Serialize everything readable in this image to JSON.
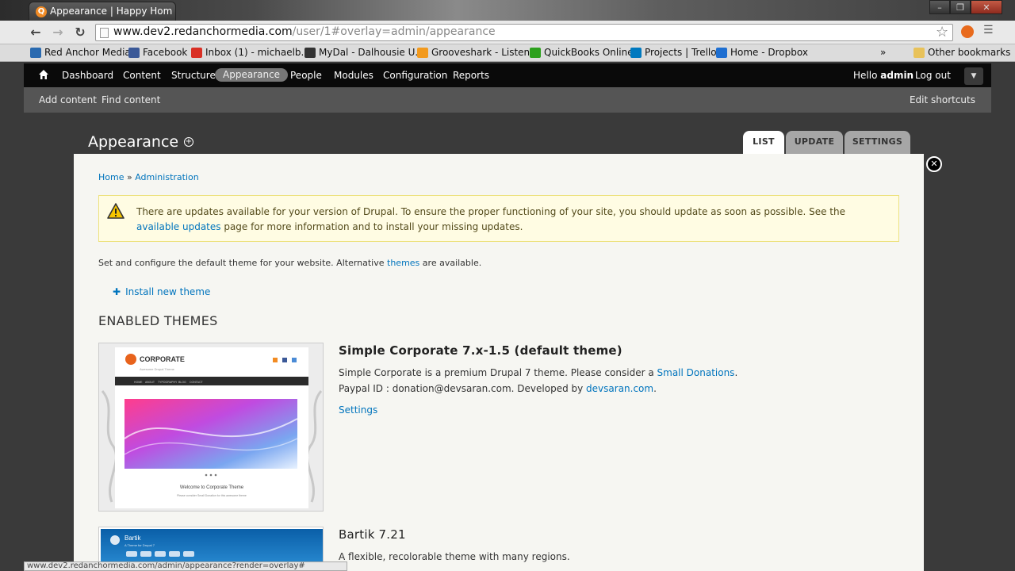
{
  "browser": {
    "tab_title": "Appearance | Happy Hom",
    "url_host": "www.dev2.redanchormedia.com",
    "url_path": "/user/1#overlay=admin/appearance",
    "window_controls": [
      "–",
      "❐",
      "✕"
    ],
    "bookmarks": [
      {
        "label": "Red Anchor Media",
        "icon_color": "#2a6ab0"
      },
      {
        "label": "Facebook",
        "icon_color": "#3b5998"
      },
      {
        "label": "Inbox (1) - michaelb...",
        "icon_color": "#d93025"
      },
      {
        "label": "MyDal - Dalhousie U...",
        "icon_color": "#333333"
      },
      {
        "label": "Grooveshark - Listen...",
        "icon_color": "#f29a1e"
      },
      {
        "label": "QuickBooks Online",
        "icon_color": "#2ca01c"
      },
      {
        "label": "Projects | Trello",
        "icon_color": "#0079bf"
      },
      {
        "label": "Home - Dropbox",
        "icon_color": "#1f6fd1"
      }
    ],
    "bookmarks_more": "»",
    "other_bookmarks": "Other bookmarks",
    "status_url": "www.dev2.redanchormedia.com/admin/appearance?render=overlay#"
  },
  "toolbar": {
    "items": [
      "Dashboard",
      "Content",
      "Structure",
      "Appearance",
      "People",
      "Modules",
      "Configuration",
      "Reports"
    ],
    "active": "Appearance",
    "hello_prefix": "Hello",
    "hello_user": "admin",
    "logout": "Log out"
  },
  "shortcuts": {
    "items": [
      "Add content",
      "Find content"
    ],
    "edit": "Edit shortcuts"
  },
  "overlay": {
    "title": "Appearance",
    "tabs": [
      "LIST",
      "UPDATE",
      "SETTINGS"
    ],
    "active_tab": "LIST"
  },
  "breadcrumb": {
    "home": "Home",
    "sep": "»",
    "admin": "Administration"
  },
  "message": {
    "text_before": "There are updates available for your version of Drupal. To ensure the proper functioning of your site, you should update as soon as possible. See the ",
    "link": "available updates",
    "text_after": " page for more information and to install your missing updates."
  },
  "intro": {
    "before": "Set and configure the default theme for your website. Alternative ",
    "link": "themes",
    "after": " are available."
  },
  "install_link": "Install new theme",
  "section_heading": "ENABLED THEMES",
  "themes": [
    {
      "name": "Simple Corporate 7.x-1.5 (default theme)",
      "desc1_before": "Simple Corporate is a premium Drupal 7 theme. Please consider a ",
      "desc1_link": "Small Donations",
      "desc1_after": ".",
      "desc2_before": "Paypal ID : donation@devsaran.com. Developed by ",
      "desc2_link": "devsaran.com",
      "desc2_after": ".",
      "settings": "Settings",
      "shot": {
        "logo": "CORPORATE",
        "tagline": "Awesome Drupal Theme",
        "nav": [
          "HOME",
          "ABOUT",
          "TYPOGRAPHY",
          "BLOG",
          "CONTACT"
        ],
        "welcome": "Welcome to Corporate Theme",
        "note": "Please consider Small Donation for this awesome theme"
      }
    },
    {
      "name": "Bartik 7.21",
      "desc": "A flexible, recolorable theme with many regions.",
      "shot": {
        "logo": "Bartik",
        "slogan": "A Theme for Drupal 7"
      }
    }
  ]
}
